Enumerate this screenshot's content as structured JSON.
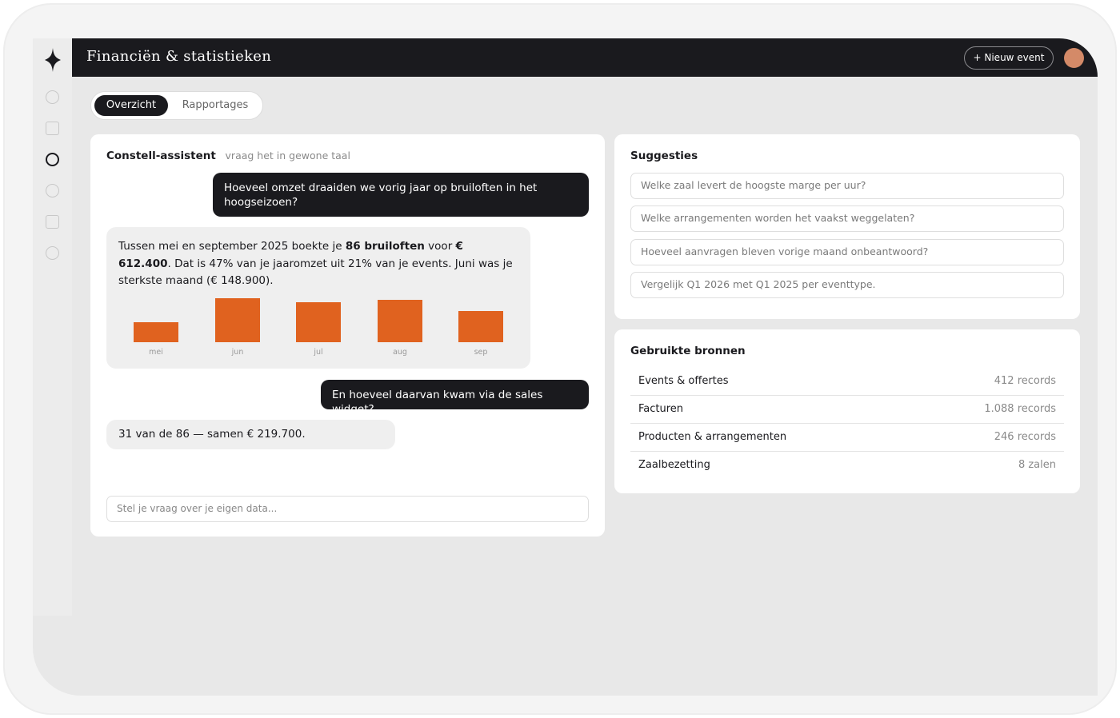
{
  "header": {
    "title": "Financiën & statistieken",
    "new_event_label": "+ Nieuw event"
  },
  "tabs": [
    {
      "label": "Overzicht",
      "active": true
    },
    {
      "label": "Rapportages",
      "active": false
    }
  ],
  "assistant": {
    "title": "Constell-assistent",
    "subtitle": "vraag het in gewone taal",
    "messages": {
      "q1": "Hoeveel omzet draaiden we vorig jaar op bruiloften in het hoogseizoen?",
      "a1_part1": "Tussen mei en september 2025 boekte je ",
      "a1_bold1": "86 bruiloften",
      "a1_part2": " voor ",
      "a1_bold2": "€ 612.400",
      "a1_part3": ". Dat is 47% van je jaaromzet uit 21% van je events. Juni was je sterkste maand (€ 148.900).",
      "q2": "En hoeveel daarvan kwam via de sales widget?",
      "a2": "31 van de 86 — samen € 219.700."
    },
    "input_placeholder": "Stel je vraag over je eigen data..."
  },
  "chart_data": {
    "type": "bar",
    "categories": [
      "mei",
      "jun",
      "jul",
      "aug",
      "sep"
    ],
    "values": [
      25,
      55,
      50,
      53,
      39
    ],
    "ylim": [
      0,
      60
    ],
    "title": "",
    "xlabel": "",
    "ylabel": "",
    "bar_color": "#e0621f",
    "grid": false
  },
  "suggestions": {
    "title": "Suggesties",
    "items": [
      "Welke zaal levert de hoogste marge per uur?",
      "Welke arrangementen worden het vaakst weggelaten?",
      "Hoeveel aanvragen bleven vorige maand onbeantwoord?",
      "Vergelijk Q1 2026 met Q1 2025 per eventtype."
    ]
  },
  "sources": {
    "title": "Gebruikte bronnen",
    "items": [
      {
        "name": "Events & offertes",
        "value": "412 records"
      },
      {
        "name": "Facturen",
        "value": "1.088 records"
      },
      {
        "name": "Producten & arrangementen",
        "value": "246 records"
      },
      {
        "name": "Zaalbezetting",
        "value": "8 zalen"
      }
    ]
  },
  "sidebar": {
    "icons": [
      "circle-icon",
      "square-icon",
      "circle-icon",
      "circle-icon",
      "square-icon",
      "circle-icon"
    ],
    "active_index": 2
  },
  "colors": {
    "accent": "#e0621f",
    "dark": "#1a1a1e",
    "avatar": "#d48a68"
  }
}
